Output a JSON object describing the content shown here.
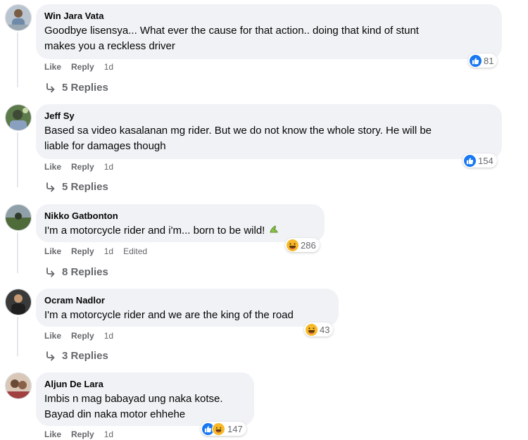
{
  "comments": [
    {
      "author": "Win Jara Vata",
      "text_lines": [
        "Goodbye lisensya... What ever the cause for that action.. doing that kind of stunt",
        "makes you a reckless driver"
      ],
      "reactions": {
        "icons": [
          "like-icon"
        ],
        "count": "81"
      },
      "actions": {
        "like": "Like",
        "reply": "Reply",
        "time": "1d"
      },
      "replies_label": "5 Replies"
    },
    {
      "author": "Jeff Sy",
      "text_lines": [
        "Based sa video kasalanan mg rider. But we do not know the whole story. He will be",
        "liable for damages though"
      ],
      "reactions": {
        "icons": [
          "like-icon"
        ],
        "count": "154"
      },
      "actions": {
        "like": "Like",
        "reply": "Reply",
        "time": "1d"
      },
      "replies_label": "5 Replies"
    },
    {
      "author": "Nikko Gatbonton",
      "text_lines": [
        "I'm a motorcycle rider and i'm... born to be wild!"
      ],
      "reactions": {
        "icons": [
          "haha-icon"
        ],
        "count": "286"
      },
      "actions": {
        "like": "Like",
        "reply": "Reply",
        "time": "1d",
        "edited": "Edited"
      },
      "replies_label": "8 Replies"
    },
    {
      "author": "Ocram Nadlor",
      "text_lines": [
        "I'm a motorcycle rider and we are the king of the road"
      ],
      "reactions": {
        "icons": [
          "haha-icon"
        ],
        "count": "43"
      },
      "actions": {
        "like": "Like",
        "reply": "Reply",
        "time": "1d"
      },
      "replies_label": "3 Replies"
    },
    {
      "author": "Aljun De Lara",
      "text_lines": [
        "Imbis n mag babayad ung naka kotse.",
        "Bayad din naka motor ehhehe"
      ],
      "reactions": {
        "icons": [
          "like-icon",
          "haha-icon"
        ],
        "count": "147"
      },
      "actions": {
        "like": "Like",
        "reply": "Reply",
        "time": "1d"
      }
    }
  ],
  "colors": {
    "bubble": "#f0f2f5",
    "like_blue": "#1877f2",
    "haha_yellow": "#f7b928",
    "secondary_text": "#65676b"
  }
}
